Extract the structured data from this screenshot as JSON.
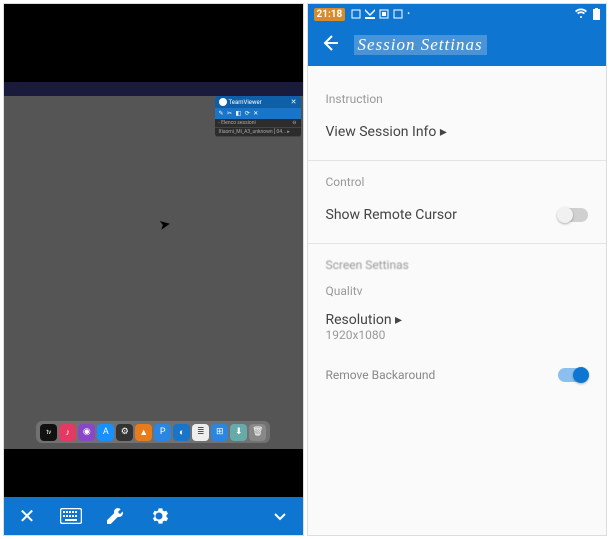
{
  "left": {
    "teamviewer_panel": {
      "brand": "TeamViewer",
      "toolbar_glyphs": "✎ ✂ ◧ ⟳ ✕",
      "session1": "- Elenco sessioni",
      "session2": "Xiaomi_Mi_A3_unknown [ 04... ▸"
    },
    "dock": [
      {
        "name": "appletv",
        "bg": "#111",
        "glyph": "tv"
      },
      {
        "name": "music",
        "bg": "#e23a61",
        "glyph": "♪"
      },
      {
        "name": "podcasts",
        "bg": "#8946c7",
        "glyph": "◉"
      },
      {
        "name": "appstore",
        "bg": "#1890ff",
        "glyph": "A"
      },
      {
        "name": "settings",
        "bg": "#333",
        "glyph": "⚙"
      },
      {
        "name": "vlc",
        "bg": "#e87b1c",
        "glyph": "▲"
      },
      {
        "name": "pages",
        "bg": "#2a86e0",
        "glyph": "P"
      },
      {
        "name": "teamviewer",
        "bg": "#1a75c9",
        "glyph": "◐"
      },
      {
        "name": "textedit",
        "bg": "#eee",
        "glyph": "≣"
      },
      {
        "name": "finder",
        "bg": "#2a86e0",
        "glyph": "⊞"
      },
      {
        "name": "downloads",
        "bg": "#6aa",
        "glyph": "⬇"
      },
      {
        "name": "trash",
        "bg": "#888",
        "glyph": "🗑"
      }
    ],
    "toolbar": {
      "close": "close-icon",
      "keyboard": "keyboard-icon",
      "wrench": "tools-icon",
      "gear": "settings-icon",
      "chevron": "chevron-down-icon"
    }
  },
  "right": {
    "status": {
      "time": "21:18",
      "right_icons": "�ω� ▮"
    },
    "title": "Session Settinas",
    "sections": {
      "instruction_label": "Instruction",
      "view_session": "View Session Info ▸",
      "control_label": "Control",
      "show_cursor": "Show Remote Cursor",
      "screen_label": "Screen Settinas",
      "quality": "Qualitv",
      "resolution_label": "Resolution ▸",
      "resolution_value": "1920x1080",
      "remove_bg": "Remove Backaround"
    }
  }
}
